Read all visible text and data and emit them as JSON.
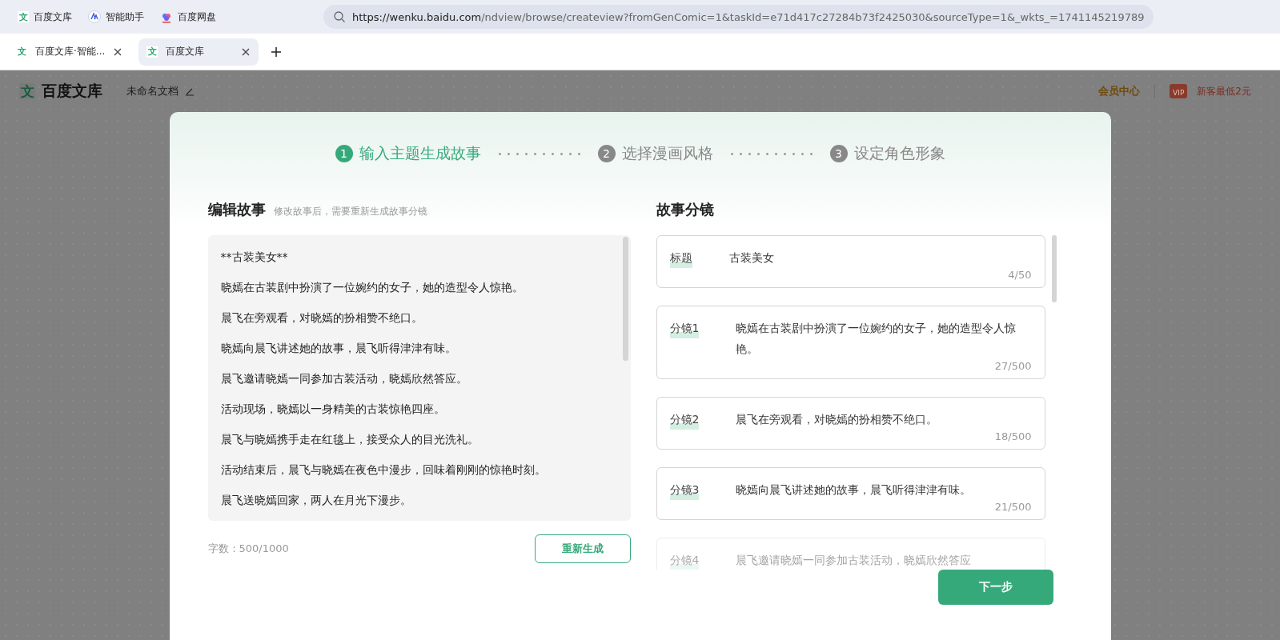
{
  "bookmarks": [
    {
      "label": "百度文库",
      "kind": "wenku",
      "icon": "文"
    },
    {
      "label": "智能助手",
      "kind": "assistant"
    },
    {
      "label": "百度网盘",
      "kind": "pan"
    }
  ],
  "address": {
    "url_host": "https://wenku.baidu.com",
    "url_path": "/ndview/browse/createview?fromGenComic=1&taskId=e71d417c27284b73f2425030&sourceType=1&_wkts_=1741145219789"
  },
  "tabs": [
    {
      "label": "百度文库·智能...",
      "icon": "文",
      "selected": false
    },
    {
      "label": "百度文库",
      "icon": "文",
      "selected": true
    }
  ],
  "header": {
    "logo_icon": "文",
    "logo": "百度文库",
    "doc_title": "未命名文档",
    "member": "会员中心",
    "promo": "新客最低2元",
    "promo_badge": "VIP"
  },
  "steps": [
    {
      "number": "1",
      "label": "输入主题生成故事",
      "selected": true
    },
    {
      "number": "2",
      "label": "选择漫画风格",
      "selected": false
    },
    {
      "number": "3",
      "label": "设定角色形象",
      "selected": false
    }
  ],
  "editor": {
    "title": "编辑故事",
    "hint": "修改故事后，需要重新生成故事分镜",
    "lines": [
      "**古装美女**",
      "晓嫣在古装剧中扮演了一位婉约的女子，她的造型令人惊艳。",
      "晨飞在旁观看，对晓嫣的扮相赞不绝口。",
      "晓嫣向晨飞讲述她的故事，晨飞听得津津有味。",
      "晨飞邀请晓嫣一同参加古装活动，晓嫣欣然答应。",
      "活动现场，晓嫣以一身精美的古装惊艳四座。",
      "晨飞与晓嫣携手走在红毯上，接受众人的目光洗礼。",
      "活动结束后，晨飞与晓嫣在夜色中漫步，回味着刚刚的惊艳时刻。",
      "晨飞送晓嫣回家，两人在月光下漫步。"
    ],
    "count": "字数：500/1000",
    "regenerate": "重新生成"
  },
  "storyboard": {
    "title": "故事分镜",
    "cards": [
      {
        "label": "标题",
        "text": "古装美女",
        "count": "4/50"
      },
      {
        "label": "分镜1",
        "text": "晓嫣在古装剧中扮演了一位婉约的女子，她的造型令人惊艳。",
        "count": "27/500"
      },
      {
        "label": "分镜2",
        "text": "晨飞在旁观看，对晓嫣的扮相赞不绝口。",
        "count": "18/500"
      },
      {
        "label": "分镜3",
        "text": "晓嫣向晨飞讲述她的故事，晨飞听得津津有味。",
        "count": "21/500"
      }
    ],
    "faded_card": {
      "label": "分镜4",
      "text": "晨飞邀请晓嫣一同参加古装活动，晓嫣欣然答应"
    }
  },
  "next": "下一步"
}
